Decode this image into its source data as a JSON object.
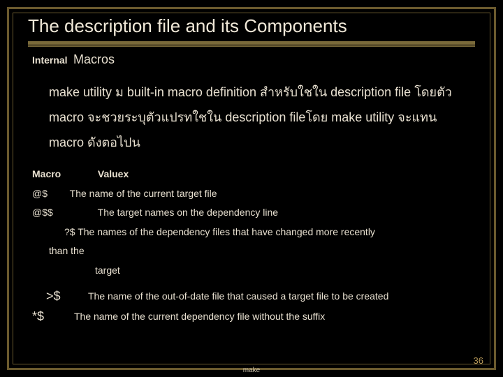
{
  "title": "The description file and its Components",
  "subhead_small": "Internal",
  "subhead_big": "Macros",
  "body": "make utility  ม    built-in macro definition สำหรับใชใน description file  โดยตัว    macro จะชวยระบุตัวแปรทใชใน description fileโดย make utility จะแทน macro ดังตอไปน",
  "table": {
    "head_macro": "Macro",
    "head_value": "Valuex",
    "r1_mac": "@$",
    "r1_desc": "The name of the current target file",
    "r2_mac": "@$$",
    "r2_desc": "The target names on the dependency line",
    "r3_mac": "?$",
    "r3_desc": "The names of the dependency files that have changed more recently",
    "r3_cont": "than the",
    "r3_cont2": "target",
    "r4_mac": ">$",
    "r4_desc": "The name of the out-of-date file that caused a target file to be created",
    "r5_mac": "*$",
    "r5_desc": "The name of the current dependency file without the suffix"
  },
  "footer": "make",
  "page": "36"
}
